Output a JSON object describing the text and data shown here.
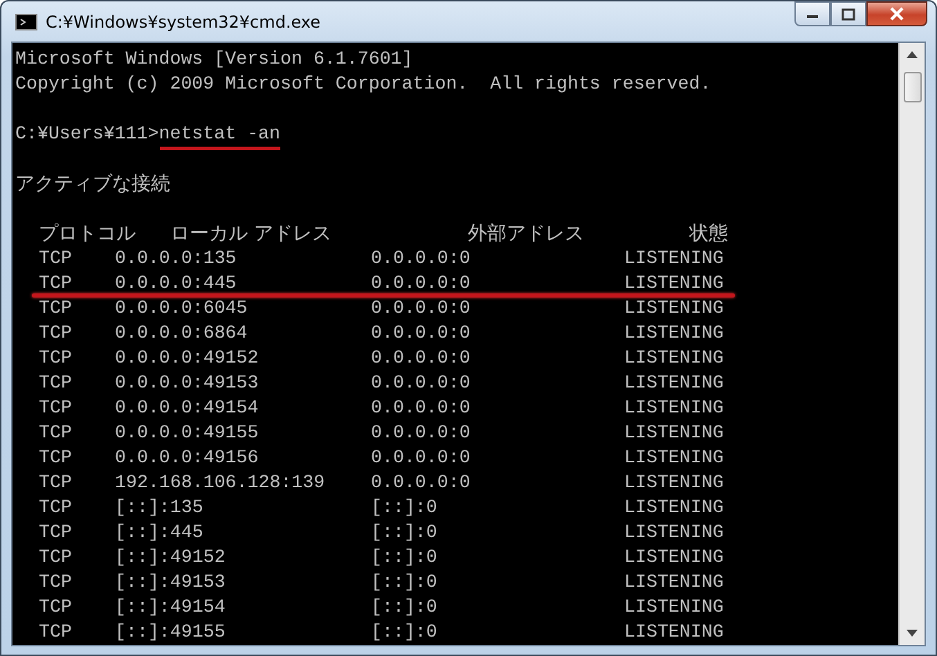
{
  "window": {
    "title": "C:¥Windows¥system32¥cmd.exe"
  },
  "console": {
    "banner": [
      "Microsoft Windows [Version 6.1.7601]",
      "Copyright (c) 2009 Microsoft Corporation.  All rights reserved."
    ],
    "prompt": {
      "path": "C:¥Users¥111>",
      "command": "netstat -an",
      "underlined": true
    },
    "section_title": "アクティブな接続",
    "columns": [
      "プロトコル",
      "ローカル アドレス",
      "外部アドレス",
      "状態"
    ],
    "rows": [
      {
        "protocol": "TCP",
        "local": "0.0.0.0:135",
        "foreign": "0.0.0.0:0",
        "state": "LISTENING",
        "underlined": false
      },
      {
        "protocol": "TCP",
        "local": "0.0.0.0:445",
        "foreign": "0.0.0.0:0",
        "state": "LISTENING",
        "underlined": true
      },
      {
        "protocol": "TCP",
        "local": "0.0.0.0:6045",
        "foreign": "0.0.0.0:0",
        "state": "LISTENING",
        "underlined": false
      },
      {
        "protocol": "TCP",
        "local": "0.0.0.0:6864",
        "foreign": "0.0.0.0:0",
        "state": "LISTENING",
        "underlined": false
      },
      {
        "protocol": "TCP",
        "local": "0.0.0.0:49152",
        "foreign": "0.0.0.0:0",
        "state": "LISTENING",
        "underlined": false
      },
      {
        "protocol": "TCP",
        "local": "0.0.0.0:49153",
        "foreign": "0.0.0.0:0",
        "state": "LISTENING",
        "underlined": false
      },
      {
        "protocol": "TCP",
        "local": "0.0.0.0:49154",
        "foreign": "0.0.0.0:0",
        "state": "LISTENING",
        "underlined": false
      },
      {
        "protocol": "TCP",
        "local": "0.0.0.0:49155",
        "foreign": "0.0.0.0:0",
        "state": "LISTENING",
        "underlined": false
      },
      {
        "protocol": "TCP",
        "local": "0.0.0.0:49156",
        "foreign": "0.0.0.0:0",
        "state": "LISTENING",
        "underlined": false
      },
      {
        "protocol": "TCP",
        "local": "192.168.106.128:139",
        "foreign": "0.0.0.0:0",
        "state": "LISTENING",
        "underlined": false
      },
      {
        "protocol": "TCP",
        "local": "[::]:135",
        "foreign": "[::]:0",
        "state": "LISTENING",
        "underlined": false
      },
      {
        "protocol": "TCP",
        "local": "[::]:445",
        "foreign": "[::]:0",
        "state": "LISTENING",
        "underlined": false
      },
      {
        "protocol": "TCP",
        "local": "[::]:49152",
        "foreign": "[::]:0",
        "state": "LISTENING",
        "underlined": false
      },
      {
        "protocol": "TCP",
        "local": "[::]:49153",
        "foreign": "[::]:0",
        "state": "LISTENING",
        "underlined": false
      },
      {
        "protocol": "TCP",
        "local": "[::]:49154",
        "foreign": "[::]:0",
        "state": "LISTENING",
        "underlined": false
      },
      {
        "protocol": "TCP",
        "local": "[::]:49155",
        "foreign": "[::]:0",
        "state": "LISTENING",
        "underlined": false
      }
    ]
  }
}
